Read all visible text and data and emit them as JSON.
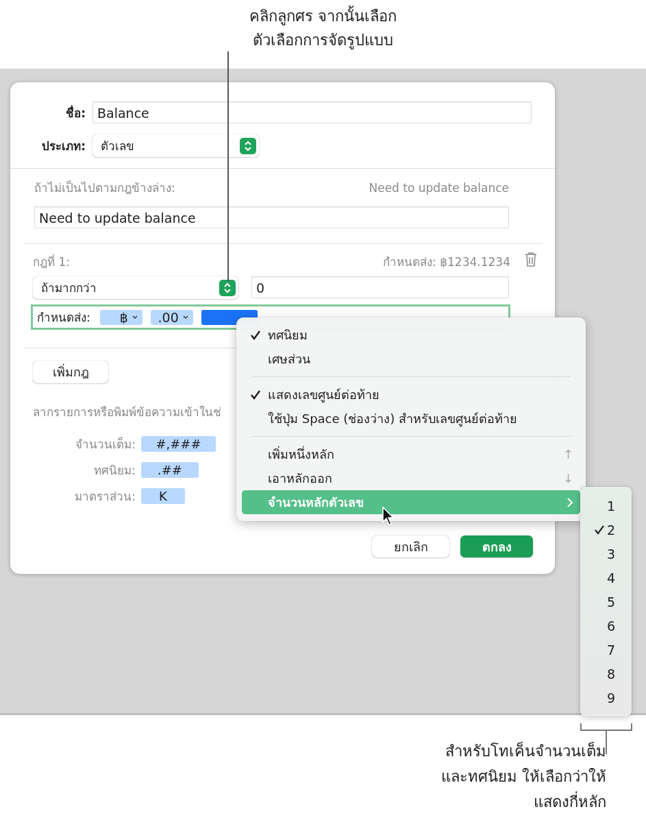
{
  "callout_top": {
    "lines": [
      "คลิกลูกศร จากนั้นเลือก",
      "ตัวเลือกการจัดรูปแบบ"
    ]
  },
  "dialog": {
    "name": {
      "label": "ชื่อ:",
      "value": "Balance"
    },
    "type": {
      "label": "ประเภท:",
      "value": "ตัวเลข"
    },
    "fallback": {
      "label": "ถ้าไม่เป็นไปตามกฎข้างล่าง:",
      "preview": "Need to update balance",
      "value": "Need to update balance"
    },
    "rule": {
      "label": "กฎที่ 1:",
      "preview": "กำหนดส่ง: ฿1234.1234",
      "condition": "ถ้ามากกว่า",
      "value": "0",
      "format_label": "กำหนดส่ง:",
      "tokens": [
        {
          "text": "฿",
          "kind": "popup",
          "selected": false
        },
        {
          "text": ".00",
          "kind": "popup",
          "selected": false
        },
        {
          "kind": "hidden",
          "selected": true
        }
      ]
    },
    "add_rule": "เพิ่มกฎ",
    "hint": "ลากรายการหรือพิมพ์ข้อความเข้าในช่",
    "token_rows": [
      {
        "label": "จำนวนเต็ม:",
        "token": "#,###"
      },
      {
        "label": "ทศนิยม:",
        "token": ".##"
      },
      {
        "label": "มาตราส่วน:",
        "token": "K"
      }
    ],
    "buttons": [
      {
        "label": "ยกเลิก",
        "kind": "secondary"
      },
      {
        "label": "ตกลง",
        "kind": "primary"
      }
    ]
  },
  "menu": {
    "items": [
      {
        "kind": "item",
        "label": "ทศนิยม",
        "checked": true,
        "highlighted": false
      },
      {
        "kind": "item",
        "label": "เศษส่วน",
        "checked": false,
        "highlighted": false
      },
      {
        "kind": "separator"
      },
      {
        "kind": "item",
        "label": "แสดงเลขศูนย์ต่อท้าย",
        "checked": true,
        "highlighted": false
      },
      {
        "kind": "item",
        "label": "ใช้ปุ่ม Space (ช่องว่าง) สำหรับเลขศูนย์ต่อท้าย",
        "checked": false,
        "highlighted": false
      },
      {
        "kind": "separator"
      },
      {
        "kind": "item",
        "label": "เพิ่มหนึ่งหลัก",
        "checked": false,
        "highlighted": false,
        "arrow": "↑"
      },
      {
        "kind": "item",
        "label": "เอาหลักออก",
        "checked": false,
        "highlighted": false,
        "arrow": "↓"
      },
      {
        "kind": "submenu",
        "label": "จำนวนหลักตัวเลข",
        "checked": false,
        "highlighted": true
      }
    ]
  },
  "submenu": {
    "items": [
      {
        "label": "1",
        "selected": false
      },
      {
        "label": "2",
        "selected": true
      },
      {
        "label": "3",
        "selected": false
      },
      {
        "label": "4",
        "selected": false
      },
      {
        "label": "5",
        "selected": false
      },
      {
        "label": "6",
        "selected": false
      },
      {
        "label": "7",
        "selected": false
      },
      {
        "label": "8",
        "selected": false
      },
      {
        "label": "9",
        "selected": false
      }
    ]
  },
  "callout_bottom": {
    "lines": [
      "สำหรับโทเค็นจำนวนเต็ม",
      "และทศนิยม ให้เลือกว่าให้",
      "แสดงกี่หลัก"
    ]
  }
}
